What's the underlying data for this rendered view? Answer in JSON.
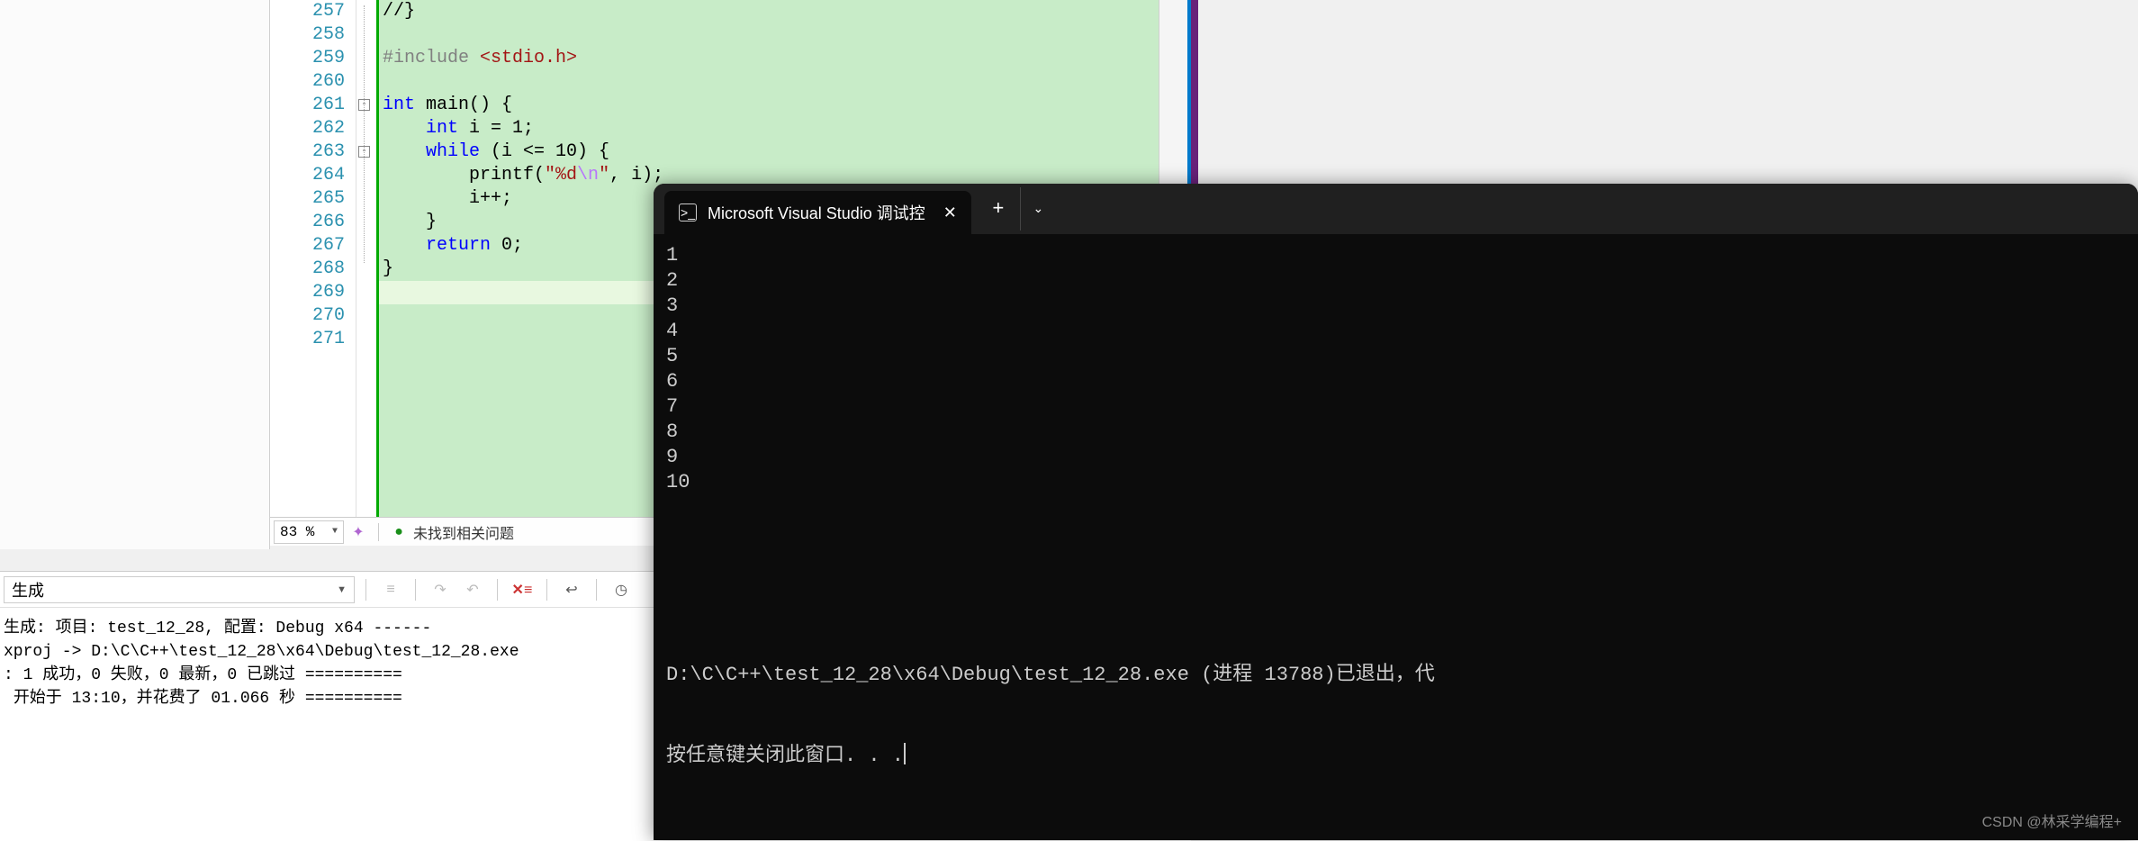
{
  "editor": {
    "lines": [
      {
        "num": 257,
        "html": "//}"
      },
      {
        "num": 258,
        "html": ""
      },
      {
        "num": 259,
        "html": "<span class='pp'>#include</span> <span class='inc'>&lt;stdio.h&gt;</span>"
      },
      {
        "num": 260,
        "html": ""
      },
      {
        "num": 261,
        "html": "<span class='kw'>int</span> main() {",
        "fold": true
      },
      {
        "num": 262,
        "html": "    <span class='kw'>int</span> i = 1;"
      },
      {
        "num": 263,
        "html": "    <span class='kw'>while</span> (i &lt;= 10) {",
        "fold": true
      },
      {
        "num": 264,
        "html": "        printf(<span class='str'>\"%d</span><span class='esc'>\\n</span><span class='str'>\"</span>, i);"
      },
      {
        "num": 265,
        "html": "        i++;"
      },
      {
        "num": 266,
        "html": "    }"
      },
      {
        "num": 267,
        "html": "    <span class='kw'>return</span> 0;"
      },
      {
        "num": 268,
        "html": "}"
      },
      {
        "num": 269,
        "html": "",
        "current": true
      },
      {
        "num": 270,
        "html": ""
      },
      {
        "num": 271,
        "html": ""
      }
    ],
    "zoom": "83 %",
    "status_text": "未找到相关问题"
  },
  "output": {
    "filter": "生成",
    "lines": [
      "生成: 项目: test_12_28, 配置: Debug x64 ------",
      "xproj -> D:\\C\\C++\\test_12_28\\x64\\Debug\\test_12_28.exe",
      ": 1 成功，0 失败，0 最新，0 已跳过 ==========",
      " 开始于 13:10，并花费了 01.066 秒 =========="
    ]
  },
  "terminal": {
    "tab_title": "Microsoft Visual Studio 调试控",
    "output": [
      "1",
      "2",
      "3",
      "4",
      "5",
      "6",
      "7",
      "8",
      "9",
      "10"
    ],
    "exit_line": "D:\\C\\C++\\test_12_28\\x64\\Debug\\test_12_28.exe (进程 13788)已退出，代",
    "prompt_line": "按任意键关闭此窗口. . ."
  },
  "watermark": "CSDN @林采学编程+"
}
